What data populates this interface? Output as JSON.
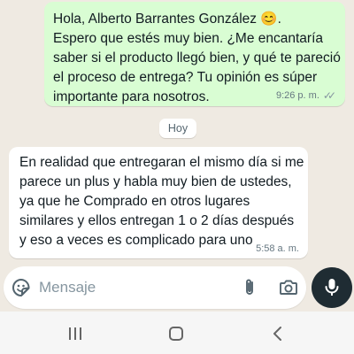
{
  "conversation": {
    "outgoing": {
      "text_line1": "Hola, Alberto Barrantes González ",
      "emoji": "😊",
      "text_line1_end": ".",
      "text_rest": "Espero que estés muy bien. ¿Me encantaría saber si el producto llegó bien, y qué te pareció el proceso de entrega? Tu opinión es súper importante para nosotros.",
      "time": "9:26 p. m.",
      "status_icon": "double-check-icon"
    },
    "day_separator": "Hoy",
    "incoming": {
      "text": "En realidad que entregaran el mismo día si me parece un plus y habla muy bien de ustedes, ya que he Comprado en otros lugares similares y ellos entregan 1 o 2 días después y eso a veces es complicado para uno",
      "time": "5:58 a. m."
    }
  },
  "composer": {
    "placeholder": "Mensaje",
    "icons": [
      "sticker-emoji-icon",
      "paperclip-icon",
      "camera-icon",
      "microphone-icon"
    ]
  },
  "system_nav": {
    "icons": [
      "recents-icon",
      "home-icon",
      "back-icon"
    ]
  },
  "colors": {
    "chat_background": "#efeae2",
    "outgoing_bubble": "#d9fdd3",
    "incoming_bubble": "#ffffff",
    "mic_button": "#1f2c33",
    "meta_text": "#667781"
  }
}
